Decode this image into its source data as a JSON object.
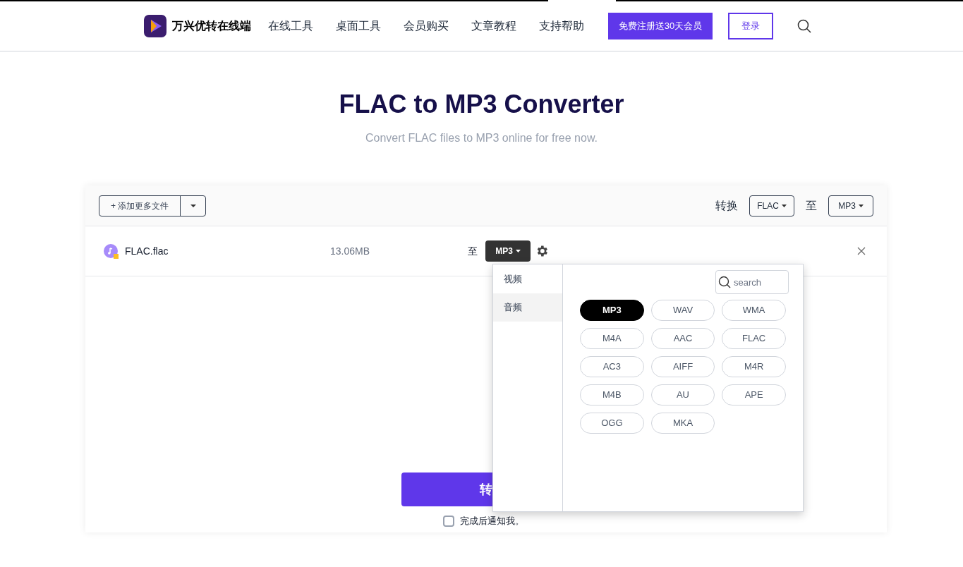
{
  "header": {
    "brand": "万兴优转在线端",
    "nav": [
      "在线工具",
      "桌面工具",
      "会员购买",
      "文章教程",
      "支持帮助"
    ],
    "signup": "免费注册送30天会员",
    "login": "登录"
  },
  "title": "FLAC to MP3 Converter",
  "subtitle": "Convert FLAC files to MP3 online for free now.",
  "toolbar": {
    "add_files": "+ 添加更多文件",
    "convert_label": "转换",
    "from_format": "FLAC",
    "to_label": "至",
    "to_format": "MP3"
  },
  "file": {
    "name": "FLAC.flac",
    "size": "13.06MB",
    "to_label": "至",
    "format": "MP3"
  },
  "format_menu": {
    "categories": [
      {
        "label": "视频",
        "selected": false
      },
      {
        "label": "音频",
        "selected": true
      }
    ],
    "search": {
      "placeholder": "search"
    },
    "formats": [
      {
        "label": "MP3",
        "selected": true
      },
      {
        "label": "WAV",
        "selected": false
      },
      {
        "label": "WMA",
        "selected": false
      },
      {
        "label": "M4A",
        "selected": false
      },
      {
        "label": "AAC",
        "selected": false
      },
      {
        "label": "FLAC",
        "selected": false
      },
      {
        "label": "AC3",
        "selected": false
      },
      {
        "label": "AIFF",
        "selected": false
      },
      {
        "label": "M4R",
        "selected": false
      },
      {
        "label": "M4B",
        "selected": false
      },
      {
        "label": "AU",
        "selected": false
      },
      {
        "label": "APE",
        "selected": false
      },
      {
        "label": "OGG",
        "selected": false
      },
      {
        "label": "MKA",
        "selected": false
      }
    ]
  },
  "convert_button": "转",
  "notify": {
    "label": "完成后通知我。",
    "checked": false
  }
}
